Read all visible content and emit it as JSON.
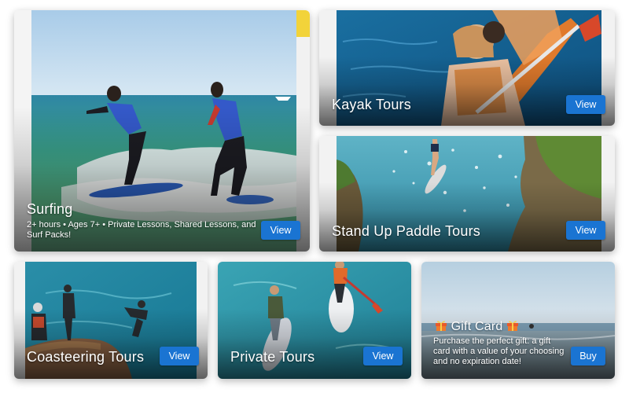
{
  "cards": {
    "surfing": {
      "title": "Surfing",
      "description": "2+ hours • Ages 7+ • Private Lessons, Shared Lessons, and Surf Packs!",
      "button": "View"
    },
    "kayak": {
      "title": "Kayak Tours",
      "button": "View"
    },
    "sup": {
      "title": "Stand Up Paddle Tours",
      "button": "View"
    },
    "coasteering": {
      "title": "Coasteering Tours",
      "button": "View"
    },
    "private": {
      "title": "Private Tours",
      "button": "View"
    },
    "gift": {
      "title": "Gift Card",
      "description": "Purchase the perfect gift: a gift card with a value of your choosing and no expiration date!",
      "button": "Buy",
      "icon": "gift-icon"
    }
  },
  "colors": {
    "button": "#1a74d2",
    "text": "#ffffff"
  }
}
